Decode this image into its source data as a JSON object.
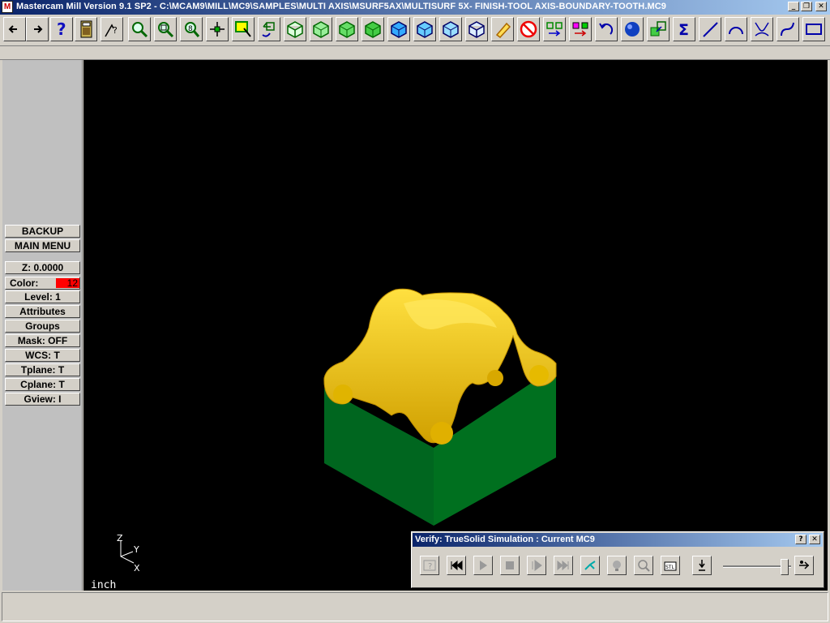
{
  "window": {
    "title": "Mastercam Mill Version 9.1 SP2 - C:\\MCAM9\\MILL\\MC9\\SAMPLES\\MULTI AXIS\\MSURF5AX\\MULTISURF 5X- FINISH-TOOL AXIS-BOUNDARY-TOOTH.MC9",
    "controls": [
      "_",
      "❐",
      "✕"
    ]
  },
  "toolbar": {
    "icons": [
      "back-arrow-icon",
      "forward-arrow-icon",
      "help-icon",
      "calculator-icon",
      "analyze-icon",
      "zoom-window-icon",
      "unzoom-icon",
      "fit-icon",
      "pan-icon",
      "select-icon",
      "rotate-view-icon",
      "iso-cube-icon",
      "top-cube-icon",
      "front-cube-icon",
      "side-cube-icon",
      "shaded-cube-icon",
      "cube-blue-icon",
      "cube-blue2-icon",
      "cube-blue3-icon",
      "cube-outline-icon",
      "eraser-icon",
      "no-erase-icon",
      "transform-icon",
      "xform-colors-icon",
      "undo-icon",
      "sphere-icon",
      "solids-icon",
      "sum-icon",
      "line-icon",
      "arc-icon",
      "fillet-icon",
      "spline-icon",
      "rectangle-icon"
    ]
  },
  "menu": {
    "backup": "BACKUP",
    "main_menu": "MAIN MENU",
    "z": "Z:  0.0000",
    "color_label": "Color:",
    "color_value": "12",
    "level": "Level:  1",
    "attributes": "Attributes",
    "groups": "Groups",
    "mask": "Mask:  OFF",
    "wcs": "WCS:   T",
    "tplane": "Tplane:  T",
    "cplane": "Cplane:  T",
    "gview": "Gview:   I"
  },
  "viewport": {
    "units": "inch",
    "triad": {
      "z": "Z",
      "y": "Y",
      "x": "X"
    },
    "colors": {
      "stock": "#006a24",
      "part": "#f0d000",
      "background": "#000000"
    }
  },
  "verify": {
    "title": "Verify: TrueSolid Simulation : Current MC9",
    "buttons": [
      "verify-help-icon",
      "rewind-icon",
      "play-icon",
      "stop-icon",
      "step-icon",
      "fast-forward-icon",
      "toolpath-icon",
      "light-icon",
      "zoom-verify-icon",
      "stl-icon",
      "tool-display-icon",
      "speed-icon"
    ],
    "speed_fraction": 0.9,
    "help_label": "?",
    "close_label": "✕"
  }
}
